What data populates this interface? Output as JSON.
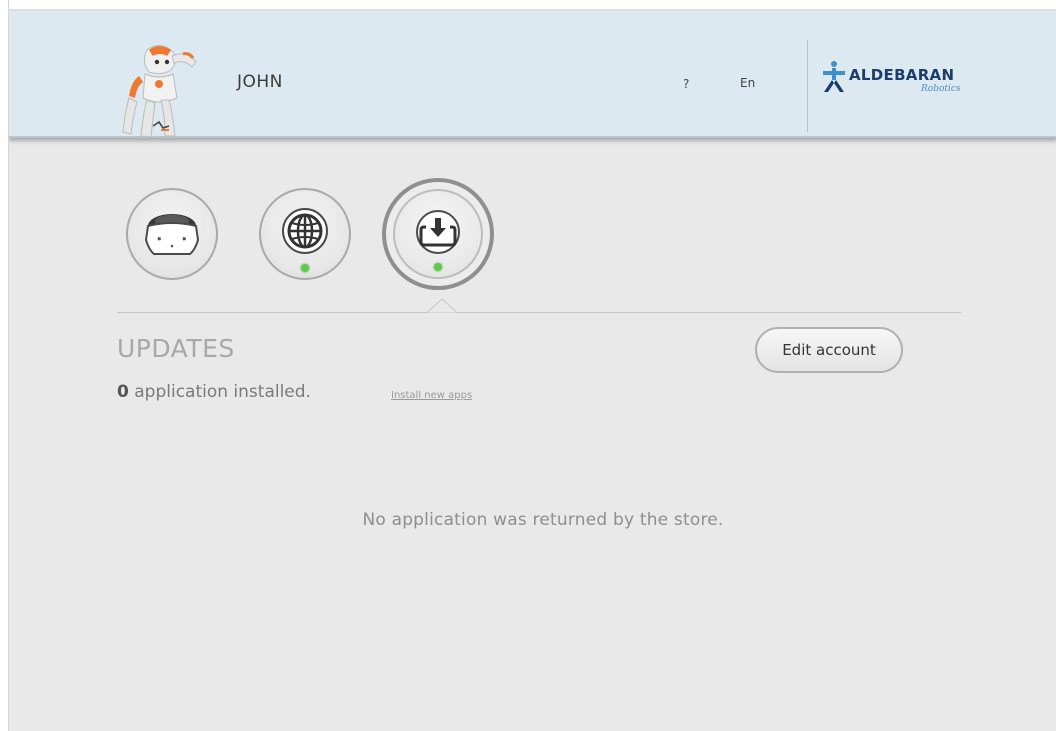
{
  "header": {
    "user_name": "JOHN",
    "help_label": "?",
    "language_label": "En",
    "logo": {
      "brand": "ALDEBARAN",
      "tagline": "Robotics",
      "color": "#1c3d6b"
    }
  },
  "nav": {
    "buttons": [
      {
        "name": "robot",
        "icon": "robot-head-icon",
        "status": null
      },
      {
        "name": "network",
        "icon": "globe-icon",
        "status": "online"
      },
      {
        "name": "updates",
        "icon": "download-icon",
        "status": "online",
        "selected": true
      }
    ],
    "status_color": "#5fcb45"
  },
  "section": {
    "title": "UPDATES",
    "installed_count": "0",
    "installed_text": " application installed.",
    "install_link": "Install new apps",
    "edit_account_label": "Edit account",
    "empty_message": "No application was returned by the store."
  }
}
